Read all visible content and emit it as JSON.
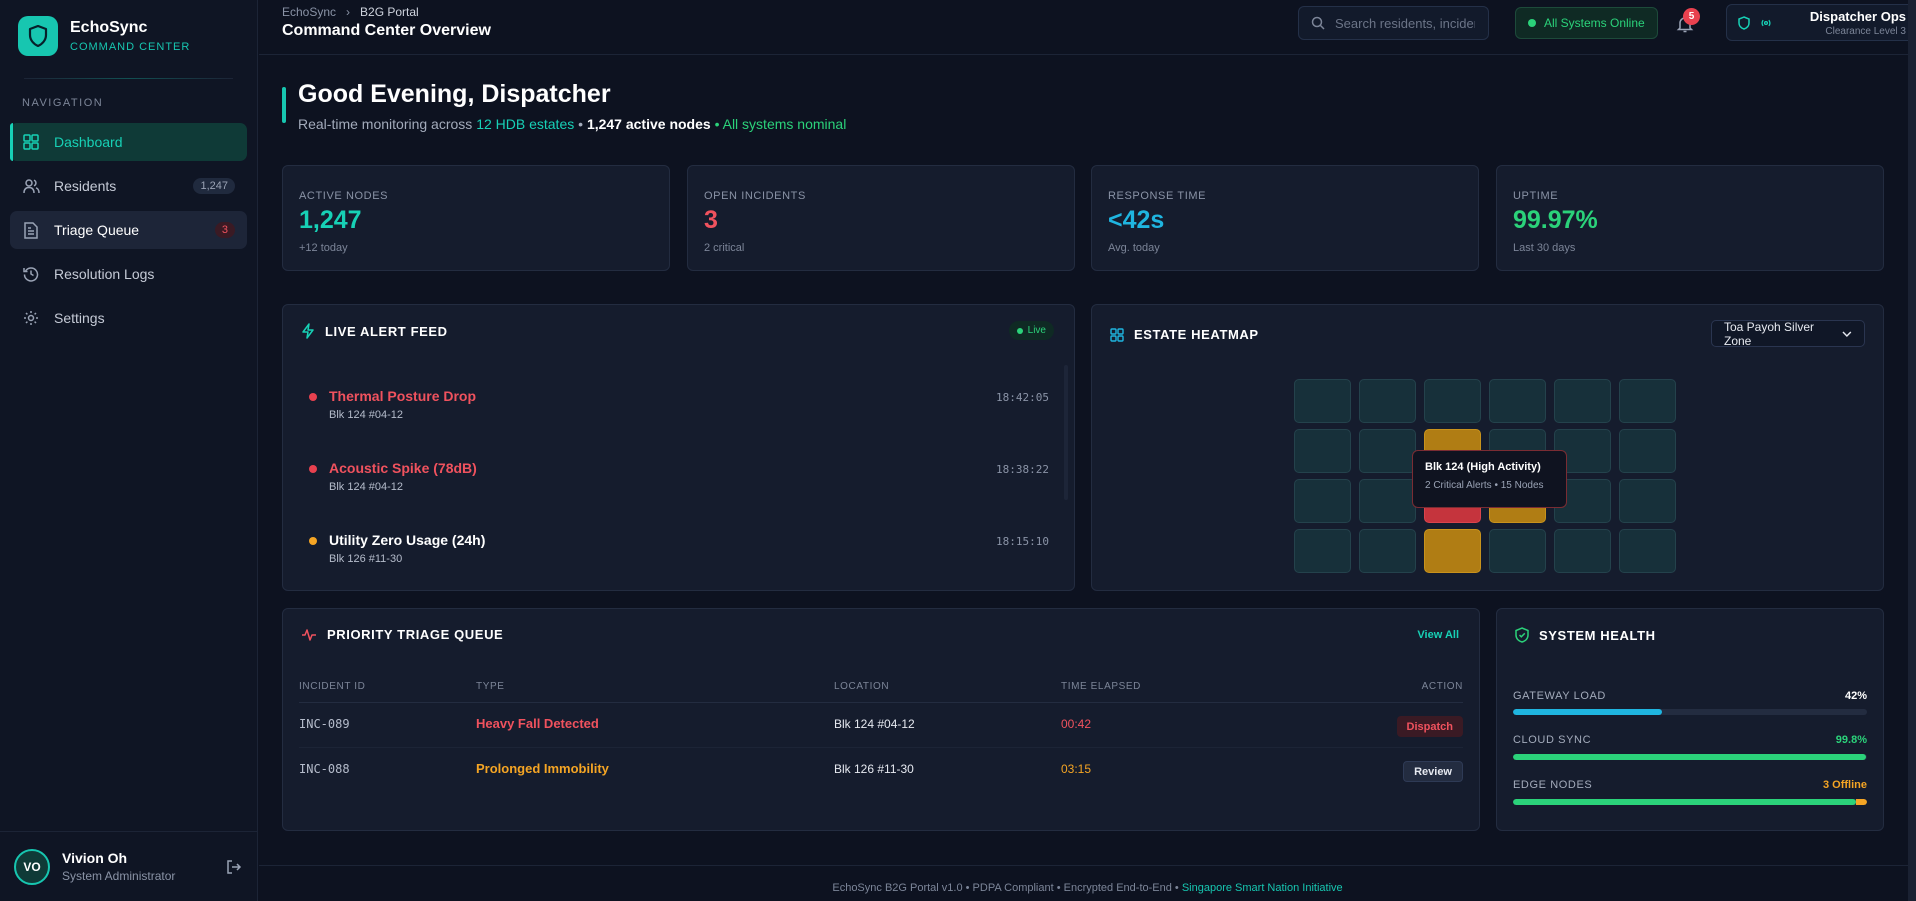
{
  "brand": {
    "name": "EchoSync",
    "subtitle": "COMMAND CENTER"
  },
  "sidebar": {
    "heading": "NAVIGATION",
    "items": [
      {
        "label": "Dashboard",
        "icon": "dashboard-icon",
        "state": "active"
      },
      {
        "label": "Residents",
        "icon": "users-icon",
        "badge": "1,247"
      },
      {
        "label": "Triage Queue",
        "icon": "document-icon",
        "badge": "3",
        "state": "highlighted"
      },
      {
        "label": "Resolution Logs",
        "icon": "history-icon"
      },
      {
        "label": "Settings",
        "icon": "gear-icon"
      }
    ]
  },
  "user": {
    "initials": "VO",
    "name": "Vivion Oh",
    "role": "System Administrator"
  },
  "header": {
    "breadcrumb": [
      "EchoSync",
      "B2G Portal"
    ],
    "title": "Command Center Overview",
    "search_placeholder": "Search residents, incidents...",
    "status": "All Systems Online",
    "notification_count": "5",
    "ops_name": "Dispatcher Ops",
    "ops_clearance": "Clearance Level 3"
  },
  "greeting": {
    "title": "Good Evening, Dispatcher",
    "prefix": "Real-time monitoring across",
    "estates": "12 HDB estates",
    "sep": "•",
    "nodes": "1,247 active nodes",
    "nominal": "All systems nominal"
  },
  "stats": [
    {
      "label": "ACTIVE NODES",
      "value": "1,247",
      "sub": "+12 today",
      "color": "#17d1b6"
    },
    {
      "label": "OPEN INCIDENTS",
      "value": "3",
      "sub": "2 critical",
      "color": "#f0525e"
    },
    {
      "label": "RESPONSE TIME",
      "value": "<42s",
      "sub": "Avg. today",
      "color": "#1fb5e0"
    },
    {
      "label": "UPTIME",
      "value": "99.97%",
      "sub": "Last 30 days",
      "color": "#2bd27a"
    }
  ],
  "alert_feed": {
    "title": "LIVE ALERT FEED",
    "live_label": "Live",
    "alerts": [
      {
        "title": "Thermal Posture Drop",
        "location": "Blk 124 #04-12",
        "time": "18:42:05",
        "severity": "critical"
      },
      {
        "title": "Acoustic Spike (78dB)",
        "location": "Blk 124 #04-12",
        "time": "18:38:22",
        "severity": "critical"
      },
      {
        "title": "Utility Zero Usage (24h)",
        "location": "Blk 126 #11-30",
        "time": "18:15:10",
        "severity": "warning"
      }
    ]
  },
  "heatmap": {
    "title": "ESTATE HEATMAP",
    "zone": "Toa Payoh Silver Zone",
    "grid": [
      [
        "normal",
        "normal",
        "normal",
        "normal",
        "normal",
        "normal"
      ],
      [
        "normal",
        "normal",
        "amber",
        "normal",
        "normal",
        "normal"
      ],
      [
        "normal",
        "normal",
        "red",
        "amber",
        "normal",
        "normal"
      ],
      [
        "normal",
        "normal",
        "amber",
        "normal",
        "normal",
        "normal"
      ]
    ],
    "tooltip_title": "Blk 124 (High Activity)",
    "tooltip_sub": "2 Critical Alerts • 15 Nodes"
  },
  "triage": {
    "title": "PRIORITY TRIAGE QUEUE",
    "view_all": "View All",
    "columns": [
      "INCIDENT ID",
      "TYPE",
      "LOCATION",
      "TIME ELAPSED",
      "ACTION"
    ],
    "rows": [
      {
        "id": "INC-089",
        "type": "Heavy Fall Detected",
        "location": "Blk 124 #04-12",
        "elapsed": "00:42",
        "action": "Dispatch",
        "severity": "critical"
      },
      {
        "id": "INC-088",
        "type": "Prolonged Immobility",
        "location": "Blk 126 #11-30",
        "elapsed": "03:15",
        "action": "Review",
        "severity": "warning"
      }
    ]
  },
  "health": {
    "title": "SYSTEM HEALTH",
    "metrics": [
      {
        "label": "GATEWAY LOAD",
        "value": "42%",
        "fill": 0.42,
        "color": "#1fb5e0",
        "value_color": "#ffffff"
      },
      {
        "label": "CLOUD SYNC",
        "value": "99.8%",
        "fill": 0.998,
        "color": "#2bd27a",
        "value_color": "#2bd27a"
      },
      {
        "label": "EDGE NODES",
        "value": "3 Offline",
        "fill": 0.97,
        "color": "#2bd27a",
        "secondary_color": "#f5a524",
        "value_color": "#f5a524"
      }
    ]
  },
  "footer": {
    "text": "EchoSync B2G Portal v1.0 • PDPA Compliant • Encrypted End-to-End •",
    "link": "Singapore Smart Nation Initiative"
  },
  "colors": {
    "accent": "#17c6b0",
    "critical": "#f0525e",
    "warning": "#f5a524",
    "ok": "#2bd27a",
    "info": "#1fb5e0"
  }
}
